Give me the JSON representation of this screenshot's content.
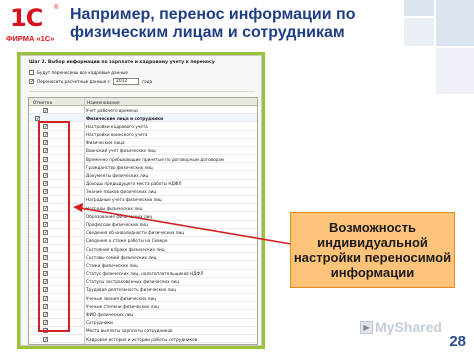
{
  "logo": {
    "mark": "1С",
    "registered": "®",
    "firm": "ФИРМА «1С»"
  },
  "headline": "Например, перенос информации по физическим лицам и сотрудникам",
  "panel": {
    "title": "Шаг 2. Выбор информации по зарплате и кадровому учету к переносу",
    "options": [
      {
        "label": "Будут перенесены все кадровые данные",
        "checked": false
      },
      {
        "label": "Переносить расчетные данные с",
        "checked": true,
        "year": "2012",
        "suffix": "года"
      }
    ],
    "col_mark": "Отметка",
    "col_name": "Наименование",
    "rows": [
      "Учет рабочего времени",
      "Физические лица и сотрудники",
      "Настройки кадрового учета",
      "Настройки воинского учета",
      "Физические лица",
      "Воинский учет физических лиц",
      "Временно пребывающие принятые по договорным договорам",
      "Гражданство физических лиц",
      "Документы физических лиц",
      "Доходы предыдущего места работы НДФЛ",
      "Знание языков физических лиц",
      "Наградные учета физических лиц",
      "Награды физических лиц",
      "Образование физических лиц",
      "Профессии физических лиц",
      "Сведения об инвалидности физических лиц",
      "Сведения о стаже работы на Севере",
      "Состояния в браке физических лиц",
      "Составы семей физических лиц",
      "Стажи физических лиц",
      "Статус физических лиц, налогоплательщиков НДФЛ",
      "Статусы застрахованных физических лиц",
      "Трудовая деятельность физических лиц",
      "Ученые звания физических лиц",
      "Ученые степени физических лиц",
      "ФИО физических лиц",
      "Сотрудники",
      "Места выплаты зарплаты сотрудников",
      "Кадровая история и истории работы сотрудников"
    ]
  },
  "callout": "Возможность индивидуальной настройки переносимой информации",
  "page_number": "28",
  "watermark": "MyShared",
  "colors": {
    "title": "#1f3f84",
    "brand_red": "#d8121a",
    "frame_green": "#9ac13a",
    "callout_bg": "#ffc37a",
    "highlight_red": "#d02222"
  }
}
